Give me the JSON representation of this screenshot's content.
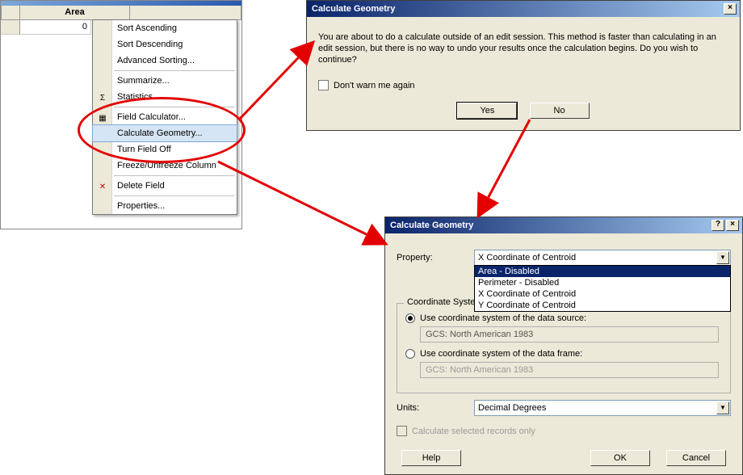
{
  "table": {
    "col_header": "Area",
    "row_value": "0"
  },
  "menu": {
    "sort_asc": "Sort Ascending",
    "sort_desc": "Sort Descending",
    "adv_sort": "Advanced Sorting...",
    "summarize": "Summarize...",
    "statistics": "Statistics...",
    "field_calc": "Field Calculator...",
    "calc_geom": "Calculate Geometry...",
    "turn_off": "Turn Field Off",
    "freeze": "Freeze/Unfreeze Column",
    "delete": "Delete Field",
    "properties": "Properties...",
    "icon_sigma": "Σ",
    "icon_calc": "▦",
    "icon_delete": "✕"
  },
  "warn": {
    "title": "Calculate Geometry",
    "text": "You are about to do a calculate outside of an edit session. This method is faster than calculating in an edit session, but there is no way to undo your results once the calculation begins. Do you wish to continue?",
    "dont_warn": "Don't warn me again",
    "yes": "Yes",
    "no": "No",
    "close": "×"
  },
  "cg": {
    "title": "Calculate Geometry",
    "help_glyph": "?",
    "close": "×",
    "property_label": "Property:",
    "property_value": "X Coordinate of Centroid",
    "options": {
      "area": "Area - Disabled",
      "perim": "Perimeter - Disabled",
      "xcent": "X Coordinate of Centroid",
      "ycent": "Y Coordinate of Centroid"
    },
    "coord_group": "Coordinate System",
    "use_coord_src": "Use coordinate system of the data source:",
    "gcs_src": "GCS: North American 1983",
    "use_coord_df": "Use coordinate system of the data frame:",
    "gcs_df": "GCS: North American 1983",
    "units_label": "Units:",
    "units_value": "Decimal Degrees",
    "calc_sel": "Calculate selected records only",
    "help": "Help",
    "ok": "OK",
    "cancel": "Cancel"
  }
}
